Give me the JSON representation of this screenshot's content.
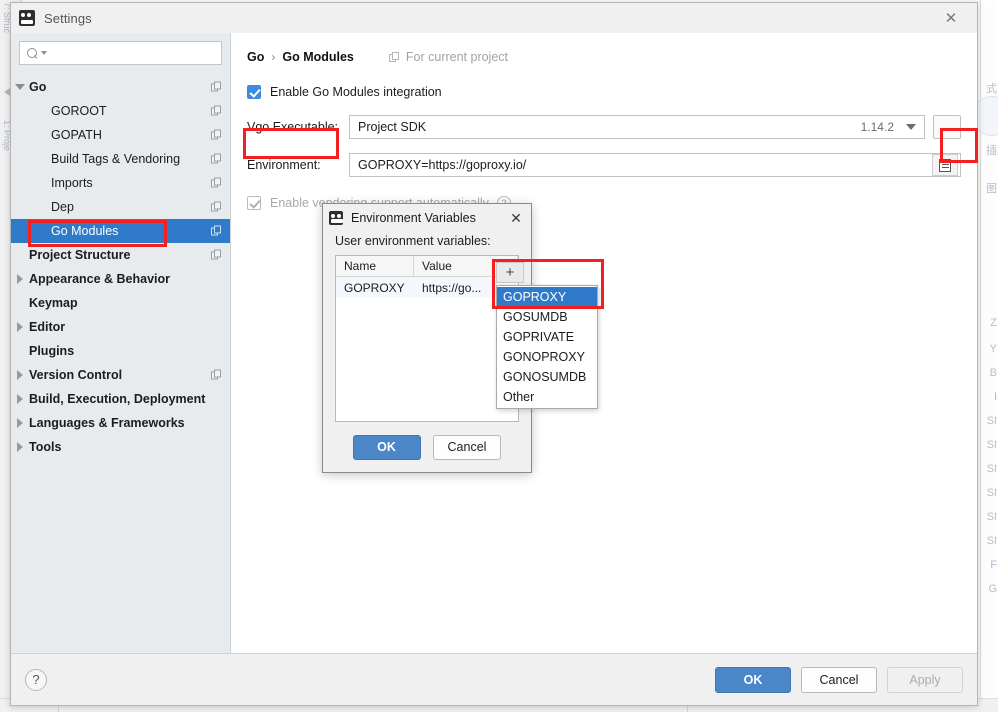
{
  "window": {
    "title": "Settings",
    "logo_icon": "go-logo-icon",
    "close_icon": "close-icon"
  },
  "search": {
    "value": "",
    "placeholder": "",
    "icon": "search-icon",
    "caret_icon": "chevron-down-icon"
  },
  "sidebar": {
    "items": [
      {
        "label": "Go",
        "level": 0,
        "twisty": "expanded",
        "bold": true,
        "copy": true,
        "selected": false
      },
      {
        "label": "GOROOT",
        "level": 1,
        "twisty": "none",
        "bold": false,
        "copy": true,
        "selected": false
      },
      {
        "label": "GOPATH",
        "level": 1,
        "twisty": "none",
        "bold": false,
        "copy": true,
        "selected": false
      },
      {
        "label": "Build Tags & Vendoring",
        "level": 1,
        "twisty": "none",
        "bold": false,
        "copy": true,
        "selected": false
      },
      {
        "label": "Imports",
        "level": 1,
        "twisty": "none",
        "bold": false,
        "copy": true,
        "selected": false
      },
      {
        "label": "Dep",
        "level": 1,
        "twisty": "none",
        "bold": false,
        "copy": true,
        "selected": false
      },
      {
        "label": "Go Modules",
        "level": 1,
        "twisty": "none",
        "bold": false,
        "copy": true,
        "selected": true
      },
      {
        "label": "Project Structure",
        "level": 0,
        "twisty": "none",
        "bold": true,
        "copy": true,
        "selected": false
      },
      {
        "label": "Appearance & Behavior",
        "level": 0,
        "twisty": "collapsed",
        "bold": true,
        "copy": false,
        "selected": false
      },
      {
        "label": "Keymap",
        "level": 0,
        "twisty": "none",
        "bold": true,
        "copy": false,
        "selected": false
      },
      {
        "label": "Editor",
        "level": 0,
        "twisty": "collapsed",
        "bold": true,
        "copy": false,
        "selected": false
      },
      {
        "label": "Plugins",
        "level": 0,
        "twisty": "none",
        "bold": true,
        "copy": false,
        "selected": false
      },
      {
        "label": "Version Control",
        "level": 0,
        "twisty": "collapsed",
        "bold": true,
        "copy": true,
        "selected": false
      },
      {
        "label": "Build, Execution, Deployment",
        "level": 0,
        "twisty": "collapsed",
        "bold": true,
        "copy": false,
        "selected": false
      },
      {
        "label": "Languages & Frameworks",
        "level": 0,
        "twisty": "collapsed",
        "bold": true,
        "copy": false,
        "selected": false
      },
      {
        "label": "Tools",
        "level": 0,
        "twisty": "collapsed",
        "bold": true,
        "copy": false,
        "selected": false
      }
    ]
  },
  "content": {
    "breadcrumb": {
      "parent": "Go",
      "separator": "›",
      "current": "Go Modules"
    },
    "for_current_project": "For current project",
    "enable_modules": {
      "label": "Enable Go Modules integration",
      "checked": true
    },
    "vgo": {
      "label": "Vgo Executable:",
      "value": "Project SDK",
      "version": "1.14.2",
      "browse_label": "..."
    },
    "environment": {
      "label": "Environment:",
      "value": "GOPROXY=https://goproxy.io/",
      "browse_icon": "list-edit-icon"
    },
    "vendoring": {
      "label": "Enable vendoring support automatically",
      "checked": true,
      "disabled": true,
      "help": "?"
    }
  },
  "dialog": {
    "title": "Environment Variables",
    "logo_icon": "go-logo-icon",
    "close_icon": "close-icon",
    "caption": "User environment variables:",
    "table": {
      "columns": [
        "Name",
        "Value"
      ],
      "rows": [
        {
          "name": "GOPROXY",
          "value": "https://go..."
        }
      ]
    },
    "add_button": "+",
    "menu_items": [
      {
        "label": "GOPROXY",
        "active": true
      },
      {
        "label": "GOSUMDB",
        "active": false
      },
      {
        "label": "GOPRIVATE",
        "active": false
      },
      {
        "label": "GONOPROXY",
        "active": false
      },
      {
        "label": "GONOSUMDB",
        "active": false
      },
      {
        "label": "Other",
        "active": false
      }
    ],
    "ok": "OK",
    "cancel": "Cancel"
  },
  "footer": {
    "help": "?",
    "ok": "OK",
    "cancel": "Cancel",
    "apply": "Apply"
  },
  "background": {
    "left_labels": [
      "7: Struc",
      "1: Proje"
    ],
    "right_chars": [
      "式",
      "插",
      "图",
      "Z",
      "Y",
      "B",
      "I",
      "SI",
      "SI",
      "SI",
      "SI",
      "SI",
      "SI",
      "F",
      "G"
    ]
  },
  "colors": {
    "accent": "#2f7bca",
    "primary_button": "#4a86c8",
    "annotation": "#f42020",
    "sidebar_bg": "#e7ebee"
  }
}
